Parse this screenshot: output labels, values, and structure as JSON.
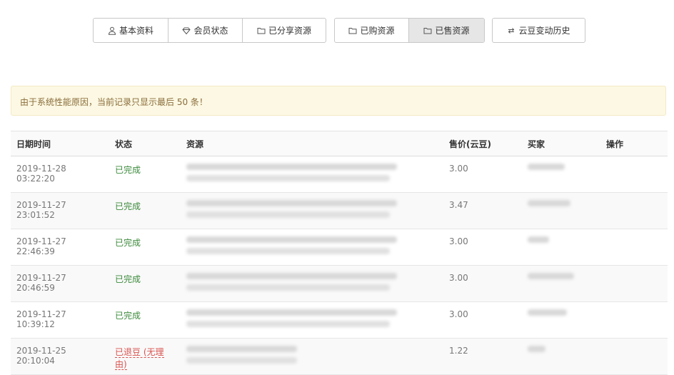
{
  "tabs": {
    "group1": [
      {
        "label": "基本资料",
        "icon": "user-icon"
      },
      {
        "label": "会员状态",
        "icon": "diamond-icon"
      },
      {
        "label": "已分享资源",
        "icon": "folder-icon"
      }
    ],
    "group2": [
      {
        "label": "已购资源",
        "icon": "folder-icon"
      },
      {
        "label": "已售资源",
        "icon": "folder-icon",
        "active": true
      }
    ],
    "group3": [
      {
        "label": "云豆变动历史",
        "icon": "exchange-icon"
      }
    ]
  },
  "alert": {
    "text": "由于系统性能原因，当前记录只显示最后 50 条！"
  },
  "table": {
    "headers": {
      "datetime": "日期时间",
      "status": "状态",
      "resource": "资源",
      "price": "售价(云豆)",
      "buyer": "买家",
      "action": "操作"
    },
    "rows": [
      {
        "datetime": "2019-11-28 03:22:20",
        "status": "已完成",
        "status_type": "completed",
        "price": "3.00"
      },
      {
        "datetime": "2019-11-27 23:01:52",
        "status": "已完成",
        "status_type": "completed",
        "price": "3.47"
      },
      {
        "datetime": "2019-11-27 22:46:39",
        "status": "已完成",
        "status_type": "completed",
        "price": "3.00"
      },
      {
        "datetime": "2019-11-27 20:46:59",
        "status": "已完成",
        "status_type": "completed",
        "price": "3.00"
      },
      {
        "datetime": "2019-11-27 10:39:12",
        "status": "已完成",
        "status_type": "completed",
        "price": "3.00"
      },
      {
        "datetime": "2019-11-25 20:10:04",
        "status": "已退豆 (无理由)",
        "status_type": "refunded",
        "price": "1.22"
      }
    ]
  },
  "colors": {
    "completed": "#3c8a3c",
    "refunded": "#d9534f",
    "alert_bg": "#fcf8e3",
    "alert_text": "#8a6d3b"
  }
}
